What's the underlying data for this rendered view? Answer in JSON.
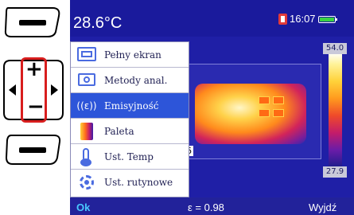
{
  "status": {
    "temperature": "28.6°C",
    "time": "16:07"
  },
  "scale": {
    "max": "54.0",
    "min": "27.9"
  },
  "thermal": {
    "range_label": "6"
  },
  "menu": {
    "items": [
      {
        "label": "Pełny ekran",
        "icon": "fullscreen-icon"
      },
      {
        "label": "Metody anal.",
        "icon": "analysis-icon"
      },
      {
        "label": "Emisyjność",
        "icon": "emissivity-icon",
        "selected": true,
        "icon_text": "((ε))"
      },
      {
        "label": "Paleta",
        "icon": "palette-icon"
      },
      {
        "label": "Ust. Temp",
        "icon": "thermometer-icon"
      },
      {
        "label": "Ust. rutynowe",
        "icon": "gear-icon"
      }
    ]
  },
  "bottom_bar": {
    "left": "Ok",
    "center": "ε = 0.98",
    "right": "Wyjdź"
  },
  "colors": {
    "screen_bg": "#1f1fa6",
    "selected_item": "#2d55d9",
    "highlight_border": "#d81e1e"
  }
}
